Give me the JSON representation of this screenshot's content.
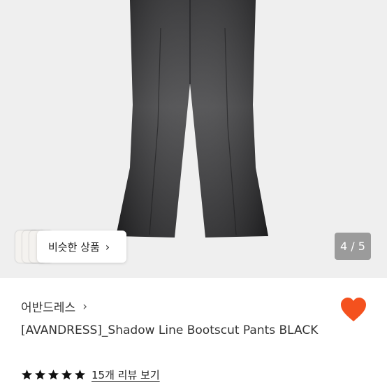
{
  "hero": {
    "similar_label": "비슷한 상품",
    "chevron": "›",
    "pager": "4 / 5"
  },
  "product": {
    "brand": "어반드레스",
    "brand_chevron": "›",
    "title": "[AVANDRESS]_Shadow Line Bootscut Pants BLACK",
    "rating": 5,
    "rating_max": 5,
    "reviews_link": "15개 리뷰 보기"
  },
  "icons": {
    "heart": "heart-icon",
    "star": "star-icon"
  },
  "colors": {
    "accent": "#f4511e",
    "pager_bg": "#9b9b9b",
    "hero_bg": "#efefef"
  }
}
